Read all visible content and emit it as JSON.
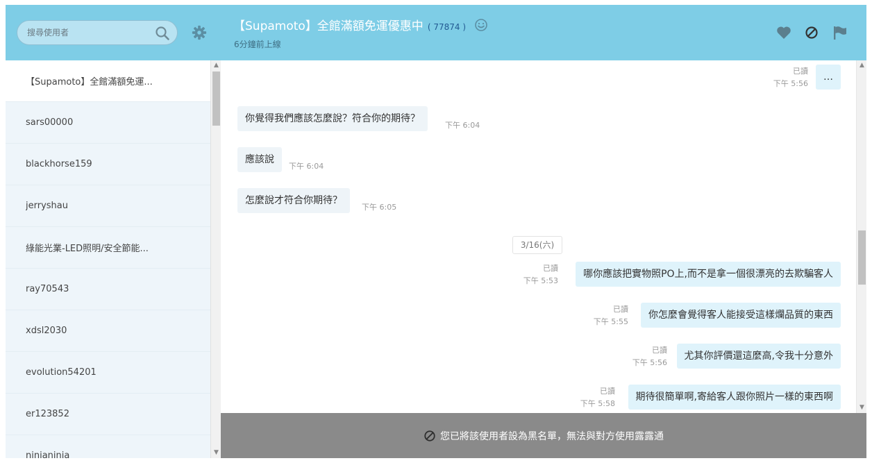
{
  "sidebar": {
    "search": {
      "placeholder": "搜尋使用者"
    },
    "contacts": [
      "【Supamoto】全館滿額免運...",
      "sars00000",
      "blackhorse159",
      "jerryshau",
      "綠能光業-LED照明/安全節能...",
      "ray70543",
      "xdsl2030",
      "evolution54201",
      "er123852",
      "ninianinia"
    ]
  },
  "header": {
    "title": "【Supamoto】全館滿額免運優惠中",
    "count_open": "(",
    "count": "77874",
    "count_close": ")",
    "last_seen": "6分鐘前上線"
  },
  "messages": {
    "m0": {
      "text": "…",
      "read": "已讀",
      "time": "下午 5:56"
    },
    "m1": {
      "text": "你覺得我們應該怎麼說？符合你的期待？",
      "time": "下午 6:04"
    },
    "m2": {
      "text": "應該說",
      "time": "下午 6:04"
    },
    "m3": {
      "text": "怎麼說才符合你期待？",
      "time": "下午 6:05"
    },
    "date": "3/16(六)",
    "m4": {
      "text": "哪你應該把實物照PO上,而不是拿一個很漂亮的去欺騙客人",
      "read": "已讀",
      "time": "下午 5:53"
    },
    "m5": {
      "text": "你怎麼會覺得客人能接受這樣爛品質的東西",
      "read": "已讀",
      "time": "下午 5:55"
    },
    "m6": {
      "text": "尤其你評價還這麼高,令我十分意外",
      "read": "已讀",
      "time": "下午 5:56"
    },
    "m7": {
      "text": "期待很簡單啊,寄給客人跟你照片一樣的東西啊",
      "read": "已讀",
      "time": "下午 5:58"
    }
  },
  "footer": {
    "text": "您已將該使用者設為黑名單，無法與對方使用露露通"
  },
  "colors": {
    "header": "#7ecde6",
    "sidebar": "#eef5fa",
    "footer": "#8a8a8a",
    "bubble_in": "#eef4f8",
    "bubble_out": "#dff3fb"
  }
}
